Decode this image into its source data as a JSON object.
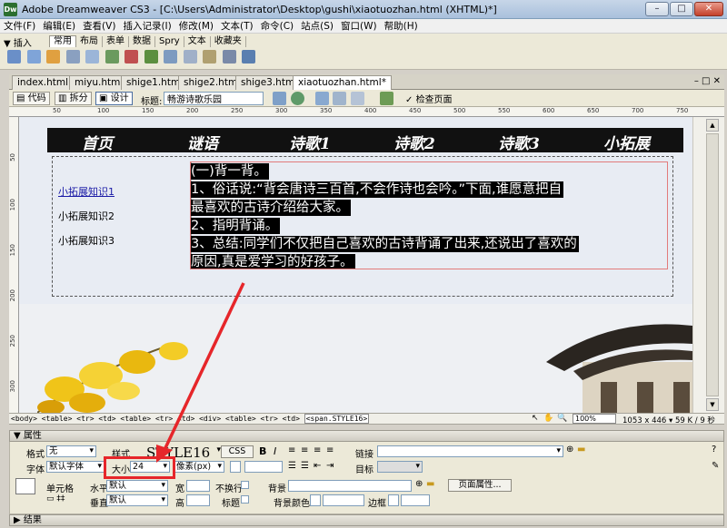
{
  "window": {
    "title": "Adobe Dreamweaver CS3 - [C:\\Users\\Administrator\\Desktop\\gushi\\xiaotuozhan.html (XHTML)*]",
    "app_icon_text": "Dw"
  },
  "menu": [
    "文件(F)",
    "编辑(E)",
    "查看(V)",
    "插入记录(I)",
    "修改(M)",
    "文本(T)",
    "命令(C)",
    "站点(S)",
    "窗口(W)",
    "帮助(H)"
  ],
  "insert_panel": {
    "header": "▼ 插入",
    "tabs": [
      "常用",
      "布局",
      "表单",
      "数据",
      "Spry",
      "文本",
      "收藏夹"
    ]
  },
  "doc_tabs": [
    "index.html",
    "miyu.html",
    "shige1.html",
    "shige2.html",
    "shige3.html",
    "xiaotuozhan.html*"
  ],
  "doc_toolbar": {
    "code": "代码",
    "split": "拆分",
    "design": "设计",
    "title_label": "标题:",
    "title_value": "畅游诗歌乐园",
    "check_page": "检查页面"
  },
  "ruler_marks": [
    "50",
    "100",
    "150",
    "200",
    "250",
    "300",
    "350",
    "400",
    "450",
    "500",
    "550",
    "600",
    "650",
    "700",
    "750"
  ],
  "ruler_v_marks": [
    "50",
    "100",
    "150",
    "200",
    "250",
    "300"
  ],
  "page": {
    "nav": [
      "首页",
      "谜语",
      "诗歌1",
      "诗歌2",
      "诗歌3",
      "小拓展"
    ],
    "side_links": [
      "小拓展知识1",
      "小拓展知识2",
      "小拓展知识3"
    ],
    "content_lines": [
      "(一)背一背。",
      "1、俗话说:“背会唐诗三百首,不会作诗也会吟。”下面,谁愿意把自",
      "最喜欢的古诗介绍给大家。",
      "2、指明背诵。",
      "3、总结:同学们不仅把自己喜欢的古诗背诵了出来,还说出了喜欢的",
      "原因,真是爱学习的好孩子。"
    ]
  },
  "status": {
    "tag_path": "<body> <table> <tr> <td> <table> <tr> <td> <div> <table> <tr> <td>",
    "selected_tag": "<span.STYLE16>",
    "zoom": "100%",
    "dimensions": "1053 x 446 ▾ 59 K / 9 秒"
  },
  "properties": {
    "header": "▼ 属性",
    "format_label": "格式",
    "format_value": "无",
    "style_label": "样式",
    "style_value": "STYLE16",
    "css_button": "CSS",
    "bold": "B",
    "italic": "I",
    "link_label": "链接",
    "font_label": "字体",
    "font_value": "默认字体",
    "size_label": "大小",
    "size_value": "24",
    "unit_value": "像素(px)",
    "target_label": "目标",
    "cell_label": "单元格",
    "horz_label": "水平",
    "horz_value": "默认",
    "vert_label": "垂直",
    "vert_value": "默认",
    "width_label": "宽",
    "height_label": "高",
    "nowrap_label": "不换行",
    "header_label": "标题",
    "bg_label": "背景",
    "bgcolor_label": "背景颜色",
    "border_label": "边框",
    "page_props_button": "页面属性...",
    "results_header": "▶ 结果"
  },
  "colors": {
    "highlight_box": "#e6262a",
    "content_bg": "#000000",
    "canvas_bg": "#e8ecf3"
  }
}
